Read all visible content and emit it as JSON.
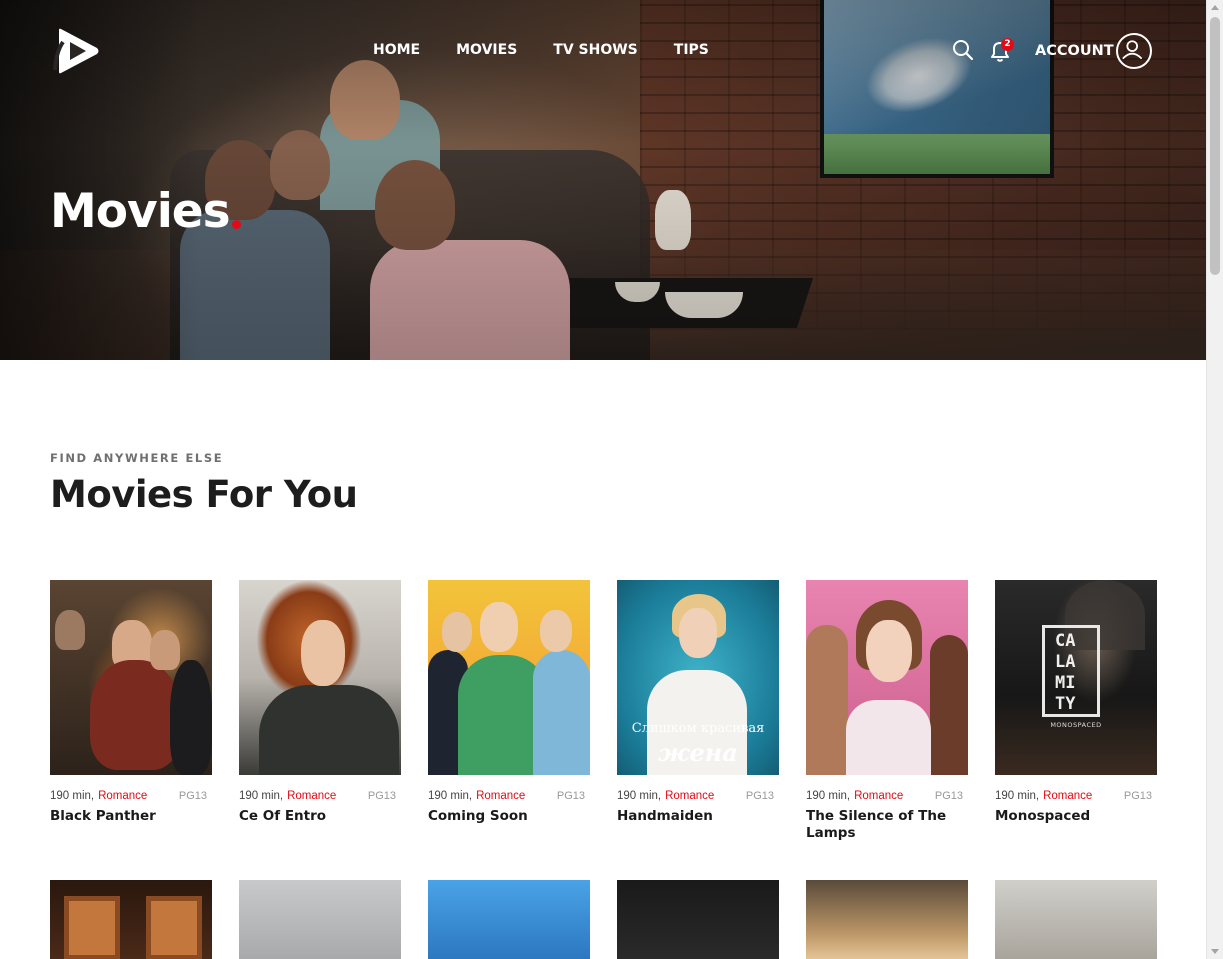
{
  "nav": {
    "items": [
      "HOME",
      "MOVIES",
      "TV SHOWS",
      "TIPS"
    ],
    "notification_count": "2",
    "account_label": "ACCOUNT",
    "icons": [
      "logo-play-icon",
      "search-icon",
      "bell-icon",
      "user-icon"
    ]
  },
  "hero": {
    "title": "Movies",
    "accent_color": "#e50914"
  },
  "section": {
    "eyebrow": "FIND ANYWHERE ELSE",
    "title": "Movies For You"
  },
  "movies": [
    {
      "duration": "190 min,",
      "genre": "Romance",
      "rating": "PG13",
      "title": "Black Panther"
    },
    {
      "duration": "190 min,",
      "genre": "Romance",
      "rating": "PG13",
      "title": "Ce Of Entro"
    },
    {
      "duration": "190 min,",
      "genre": "Romance",
      "rating": "PG13",
      "title": "Coming Soon"
    },
    {
      "duration": "190 min,",
      "genre": "Romance",
      "rating": "PG13",
      "title": "Handmaiden"
    },
    {
      "duration": "190 min,",
      "genre": "Romance",
      "rating": "PG13",
      "title": "The Silence of The Lamps"
    },
    {
      "duration": "190 min,",
      "genre": "Romance",
      "rating": "PG13",
      "title": "Monospaced"
    }
  ],
  "posters": {
    "handmaiden_text_1": "Слишком красивая",
    "handmaiden_text_2": "жена",
    "monospaced_logo": [
      "CA",
      "LA",
      "MI",
      "TY"
    ],
    "monospaced_brand": "MONOSPACED"
  }
}
